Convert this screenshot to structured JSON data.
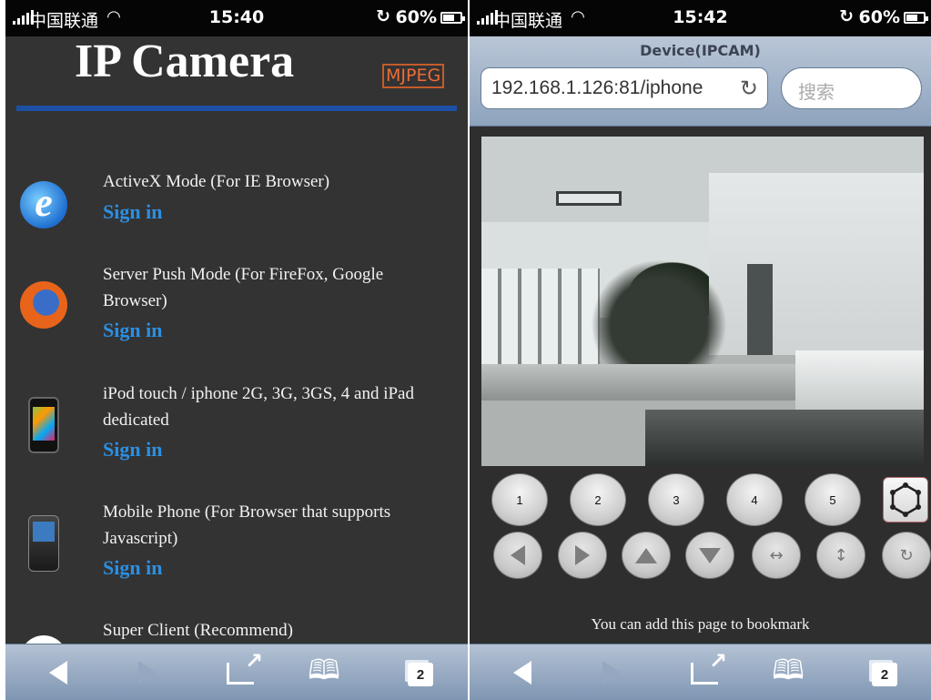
{
  "left": {
    "status": {
      "carrier": "中国联通",
      "time": "15:40",
      "battery": "60%"
    },
    "title": "IP Camera",
    "badge": "MJPEG",
    "modes": [
      {
        "icon": "ie-browser-icon",
        "desc": "ActiveX Mode (For IE Browser)",
        "signin": "Sign in"
      },
      {
        "icon": "firefox-icon",
        "desc": "Server Push Mode (For FireFox, Google Browser)",
        "signin": "Sign in"
      },
      {
        "icon": "iphone-icon",
        "desc": "iPod touch / iphone 2G, 3G, 3GS, 4 and iPad dedicated",
        "signin": "Sign in"
      },
      {
        "icon": "mobile-phone-icon",
        "desc": "Mobile Phone (For Browser that supports Javascript)",
        "signin": "Sign in"
      },
      {
        "icon": "super-client-icon",
        "desc": "Super Client (Recommend)"
      }
    ],
    "toolbar": {
      "tabs_count": "2"
    }
  },
  "right": {
    "status": {
      "carrier": "中国联通",
      "time": "15:42",
      "battery": "60%"
    },
    "page_title": "Device(IPCAM)",
    "url": "192.168.1.126:81/iphone",
    "search_placeholder": "搜索",
    "presets": [
      "1",
      "2",
      "3",
      "4",
      "5"
    ],
    "bookmark_note": "You can add this page to bookmark",
    "toolbar": {
      "tabs_count": "2"
    }
  },
  "colors": {
    "signin": "#2c8fe3",
    "title_rule": "#1d4fa4",
    "badge": "#f06b35",
    "page_bg": "#333333"
  }
}
